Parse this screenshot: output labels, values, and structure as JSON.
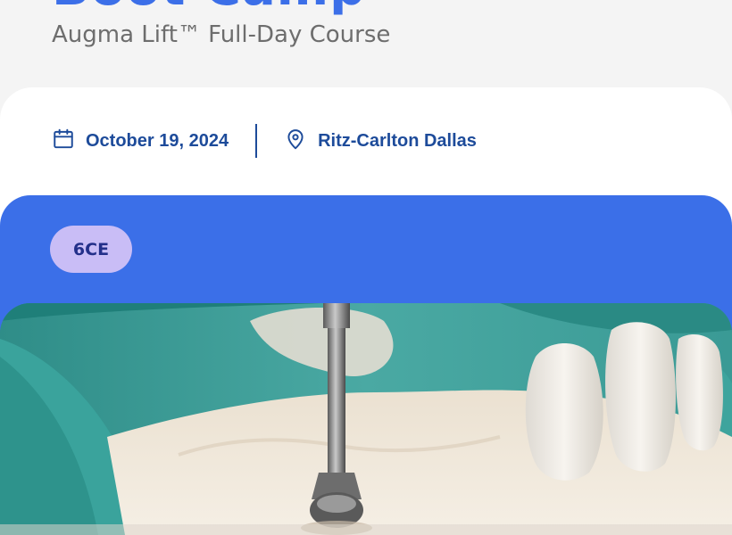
{
  "header": {
    "title_partial": "Boot Camp",
    "subtitle": "Augma Lift™ Full-Day Course"
  },
  "event_info": {
    "date": "October 19, 2024",
    "location": "Ritz-Carlton Dallas",
    "date_icon": "calendar-icon",
    "location_icon": "map-pin-icon"
  },
  "course": {
    "ce_badge": "6CE",
    "hero_image": "dental-drill-on-jaw-model"
  },
  "colors": {
    "accent_blue": "#3b6fe8",
    "text_navy": "#1d4b9a",
    "badge_lavender": "#c9bdf6"
  }
}
